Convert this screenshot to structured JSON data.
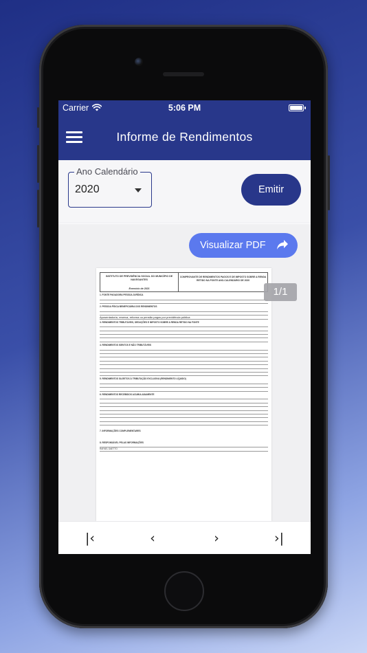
{
  "status_bar": {
    "carrier": "Carrier",
    "time": "5:06 PM"
  },
  "header": {
    "title": "Informe de Rendimentos"
  },
  "filter": {
    "label": "Ano Calendário",
    "value": "2020"
  },
  "actions": {
    "emitir_label": "Emitir",
    "visualizar_pdf_label": "Visualizar PDF"
  },
  "viewer": {
    "page_indicator": "1/1"
  },
  "document": {
    "left_header": "INSTITUTO DE PREVIDÊNCIA SOCIAL DO MUNICÍPIO DE NAVEGANTES",
    "exercise": "Exercício de 2021",
    "right_header": "COMPROVANTE DE RENDIMENTOS PAGOS E DE IMPOSTO SOBRE A RENDA RETIDO NA FONTE ANO-CALENDÁRIO DE 2020",
    "section1": "1. FONTE PAGADORA PESSOA JURÍDICA",
    "section2": "2. PESSOA FÍSICA BENEFICIÁRIA DOS RENDIMENTOS",
    "nature": "Aposentadoria, reserva, reforma ou pensão pagos por previdência pública",
    "section3": "3. RENDIMENTOS TRIBUTÁVEIS, DEDUÇÕES E IMPOSTO SOBRE A RENDA RETIDO NA FONTE",
    "section4": "4. RENDIMENTOS ISENTOS E NÃO TRIBUTÁVEIS",
    "section5": "5. RENDIMENTOS SUJEITOS À TRIBUTAÇÃO EXCLUSIVA (RENDIMENTO LÍQUIDO)",
    "section6": "6. RENDIMENTOS RECEBIDOS ACUMULADAMENTE",
    "section7": "7. INFORMAÇÕES COMPLEMENTARES",
    "section8": "8. RESPONSÁVEL PELAS INFORMAÇÕES",
    "responsible": "RAFAEL DAETTO",
    "values_header": "Valores em Reais"
  },
  "nav": {
    "first": "|‹",
    "prev": "‹",
    "next": "›",
    "last": "›|"
  }
}
